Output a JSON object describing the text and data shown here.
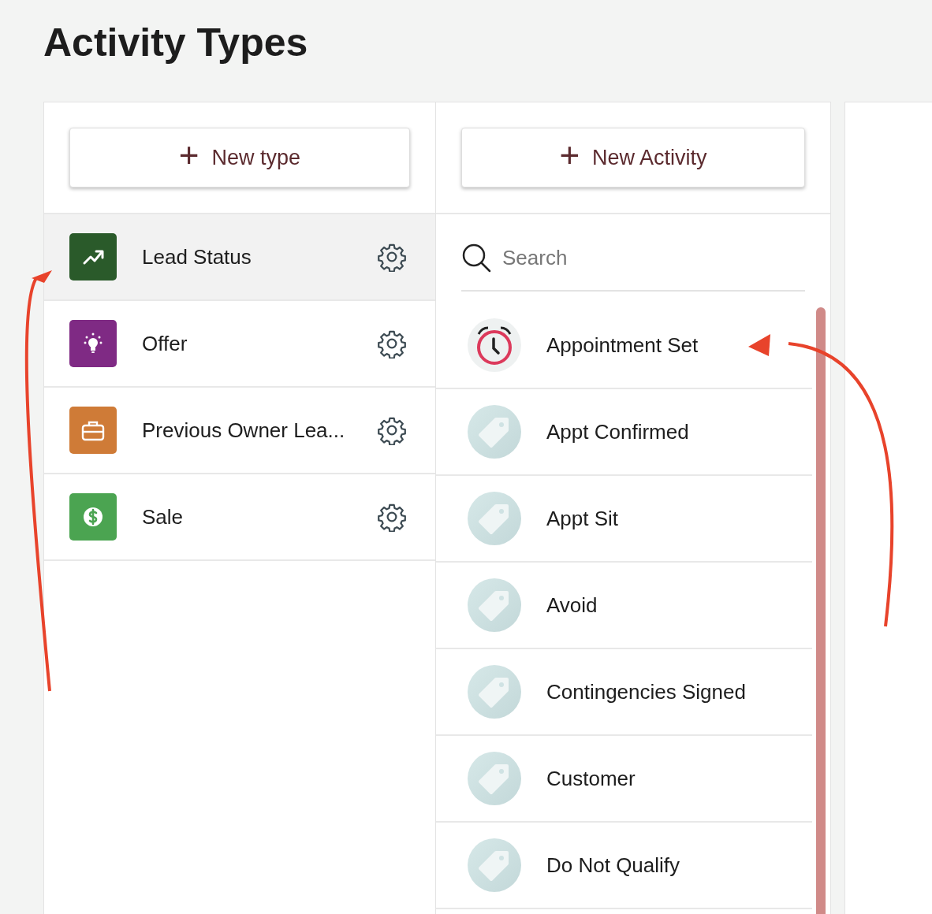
{
  "page": {
    "title": "Activity Types"
  },
  "types_panel": {
    "new_button": {
      "icon": "+",
      "label": "New type"
    },
    "items": [
      {
        "label": "Lead Status",
        "kind": "trend",
        "color": "#2a5a2a",
        "selected": true
      },
      {
        "label": "Offer",
        "kind": "bulb",
        "color": "#7f2a84",
        "selected": false
      },
      {
        "label": "Previous Owner Lea...",
        "kind": "briefcase",
        "color": "#cf7b37",
        "selected": false
      },
      {
        "label": "Sale",
        "kind": "dollar",
        "color": "#4ba451",
        "selected": false
      }
    ]
  },
  "activities_panel": {
    "new_button": {
      "icon": "+",
      "label": "New Activity"
    },
    "search": {
      "placeholder": "Search"
    },
    "items": [
      {
        "label": "Appointment Set",
        "kind": "alarm"
      },
      {
        "label": "Appt Confirmed",
        "kind": "tag"
      },
      {
        "label": "Appt Sit",
        "kind": "tag"
      },
      {
        "label": "Avoid",
        "kind": "tag"
      },
      {
        "label": "Contingencies Signed",
        "kind": "tag"
      },
      {
        "label": "Customer",
        "kind": "tag"
      },
      {
        "label": "Do Not Qualify",
        "kind": "tag"
      }
    ]
  }
}
